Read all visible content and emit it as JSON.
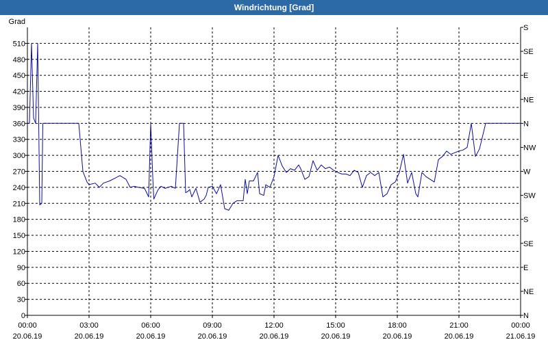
{
  "window": {
    "title": "Windrichtung [Grad]"
  },
  "chart_data": {
    "type": "line",
    "title": "Windrichtung [Grad]",
    "ylabel": "Grad",
    "xlabel": "",
    "ylim": [
      0,
      540
    ],
    "y_ticks": [
      0,
      30,
      60,
      90,
      120,
      150,
      180,
      210,
      240,
      270,
      300,
      330,
      360,
      390,
      420,
      450,
      480,
      510
    ],
    "right_axis_labels": [
      {
        "value": 0,
        "label": "N"
      },
      {
        "value": 45,
        "label": "NE"
      },
      {
        "value": 90,
        "label": "E"
      },
      {
        "value": 135,
        "label": "SE"
      },
      {
        "value": 180,
        "label": "S"
      },
      {
        "value": 225,
        "label": "SW"
      },
      {
        "value": 270,
        "label": "W"
      },
      {
        "value": 315,
        "label": "NW"
      },
      {
        "value": 360,
        "label": "N"
      },
      {
        "value": 405,
        "label": "NE"
      },
      {
        "value": 450,
        "label": "E"
      },
      {
        "value": 495,
        "label": "SE"
      },
      {
        "value": 540,
        "label": "S"
      }
    ],
    "x_ticks": [
      {
        "h": 0,
        "time": "00:00",
        "date": "20.06.19"
      },
      {
        "h": 3,
        "time": "03:00",
        "date": "20.06.19"
      },
      {
        "h": 6,
        "time": "06:00",
        "date": "20.06.19"
      },
      {
        "h": 9,
        "time": "09:00",
        "date": "20.06.19"
      },
      {
        "h": 12,
        "time": "12:00",
        "date": "20.06.19"
      },
      {
        "h": 15,
        "time": "15:00",
        "date": "20.06.19"
      },
      {
        "h": 18,
        "time": "18:00",
        "date": "20.06.19"
      },
      {
        "h": 21,
        "time": "21:00",
        "date": "20.06.19"
      },
      {
        "h": 24,
        "time": "00:00",
        "date": "21.06.19"
      }
    ],
    "xlim": [
      0,
      24
    ],
    "grid": true,
    "colors": {
      "line": "#0a0aa0",
      "grid": "#000000",
      "title_bar": "#2c6aa5"
    },
    "series": [
      {
        "x": [
          0,
          0.1,
          0.2,
          0.3,
          0.4,
          0.5,
          0.55,
          0.6,
          0.7,
          0.75,
          0.85,
          1.0,
          1.2,
          1.6,
          2.0,
          2.5,
          2.7,
          2.9,
          3.0,
          3.3,
          3.5,
          3.7,
          4.0,
          4.3,
          4.5,
          4.8,
          5.0,
          5.2,
          5.4,
          5.7,
          5.9,
          6.0,
          6.1,
          6.15,
          6.2,
          6.35,
          6.5,
          6.7,
          6.85,
          7.0,
          7.2,
          7.4,
          7.6,
          7.7,
          7.8,
          7.9,
          8.0,
          8.2,
          8.4,
          8.6,
          8.7,
          8.8,
          9.0,
          9.2,
          9.4,
          9.6,
          9.8,
          10.0,
          10.2,
          10.5,
          10.6,
          10.7,
          10.8,
          11.0,
          11.2,
          11.3,
          11.5,
          11.6,
          11.8,
          12.0,
          12.2,
          12.4,
          12.6,
          12.8,
          13.0,
          13.2,
          13.3,
          13.5,
          13.7,
          13.9,
          14.1,
          14.3,
          14.5,
          14.7,
          14.9,
          15.1,
          15.3,
          15.5,
          15.7,
          15.9,
          16.1,
          16.3,
          16.5,
          16.7,
          16.9,
          17.1,
          17.3,
          17.5,
          17.7,
          17.9,
          18.1,
          18.3,
          18.5,
          18.7,
          18.9,
          19.0,
          19.2,
          19.4,
          19.6,
          19.8,
          20.0,
          20.2,
          20.4,
          20.6,
          20.8,
          21.0,
          21.2,
          21.4,
          21.6,
          21.8,
          22.0,
          22.3,
          22.6,
          22.8,
          23.0,
          23.2,
          23.4,
          23.6,
          23.8,
          24.0
        ],
        "y": [
          360,
          360,
          510,
          370,
          360,
          510,
          360,
          207,
          210,
          360,
          360,
          360,
          360,
          360,
          360,
          360,
          270,
          250,
          245,
          248,
          240,
          248,
          252,
          258,
          262,
          255,
          240,
          242,
          240,
          238,
          222,
          360,
          260,
          218,
          222,
          235,
          242,
          238,
          240,
          242,
          238,
          360,
          360,
          230,
          232,
          236,
          222,
          238,
          212,
          218,
          225,
          240,
          242,
          228,
          245,
          200,
          197,
          210,
          215,
          215,
          255,
          228,
          252,
          252,
          268,
          228,
          225,
          245,
          240,
          260,
          300,
          280,
          268,
          275,
          272,
          282,
          275,
          255,
          260,
          290,
          272,
          282,
          275,
          278,
          272,
          268,
          265,
          265,
          262,
          272,
          268,
          240,
          262,
          268,
          262,
          268,
          222,
          228,
          245,
          250,
          268,
          302,
          248,
          268,
          228,
          222,
          268,
          260,
          255,
          250,
          292,
          298,
          308,
          302,
          305,
          308,
          310,
          315,
          360,
          298,
          312,
          360,
          360,
          360,
          360,
          360,
          360,
          360,
          360,
          360
        ]
      }
    ]
  }
}
